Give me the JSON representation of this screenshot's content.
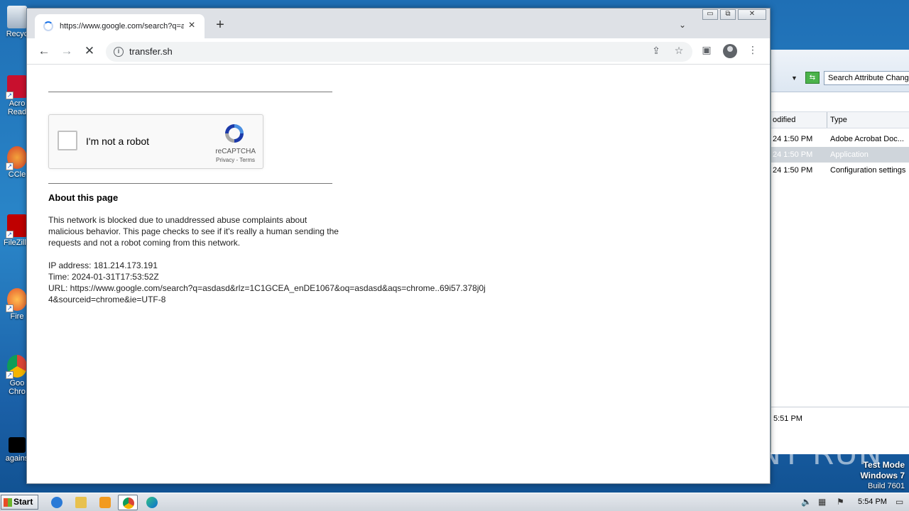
{
  "desktop": {
    "icons": [
      {
        "label": "Recyc",
        "color": "#c8d4e0"
      },
      {
        "label": "Acro Read",
        "color": "#c8102e"
      },
      {
        "label": "CCle",
        "color": "#d43f2a"
      },
      {
        "label": "FileZilla",
        "color": "#bf0000"
      },
      {
        "label": "Fire",
        "color": "#f37a1f"
      },
      {
        "label": "Goo Chro",
        "color": "#3a8b3a"
      },
      {
        "label": "agains",
        "color": "#000000"
      }
    ]
  },
  "background_window": {
    "search_placeholder": "Search Attribute Chang",
    "columns": [
      "odified",
      "Type"
    ],
    "rows": [
      {
        "modified": "24 1:50 PM",
        "type": "Adobe Acrobat Doc...",
        "selected": false
      },
      {
        "modified": "24 1:50 PM",
        "type": "Application",
        "selected": true
      },
      {
        "modified": "24 1:50 PM",
        "type": "Configuration settings",
        "selected": false
      }
    ],
    "status_time": "5:51 PM"
  },
  "browser": {
    "tab_title": "https://www.google.com/search?q=asdasd",
    "tab_close_icon": "×",
    "new_tab_icon": "+",
    "url": "transfer.sh",
    "window_controls": [
      "▭",
      "⧉",
      "✕"
    ]
  },
  "page": {
    "recaptcha": {
      "label": "I'm not a robot",
      "brand": "reCAPTCHA",
      "links": "Privacy - Terms"
    },
    "about_title": "About this page",
    "description": "This network is blocked due to unaddressed abuse complaints about malicious behavior. This page checks to see if it's really a human sending the requests and not a robot coming from this network.",
    "ip_line": "IP address: 181.214.173.191",
    "time_line": "Time: 2024-01-31T17:53:52Z",
    "url_line": "URL: https://www.google.com/search?q=asdasd&rlz=1C1GCEA_enDE1067&oq=asdasd&aqs=chrome..69i57.378j0j4&sourceid=chrome&ie=UTF-8"
  },
  "watermark": "ANY RUN",
  "test_mode": {
    "line1": "Test Mode",
    "line2": "Windows 7",
    "line3": "Build 7601"
  },
  "taskbar": {
    "start_label": "Start",
    "clock": "5:54 PM"
  }
}
